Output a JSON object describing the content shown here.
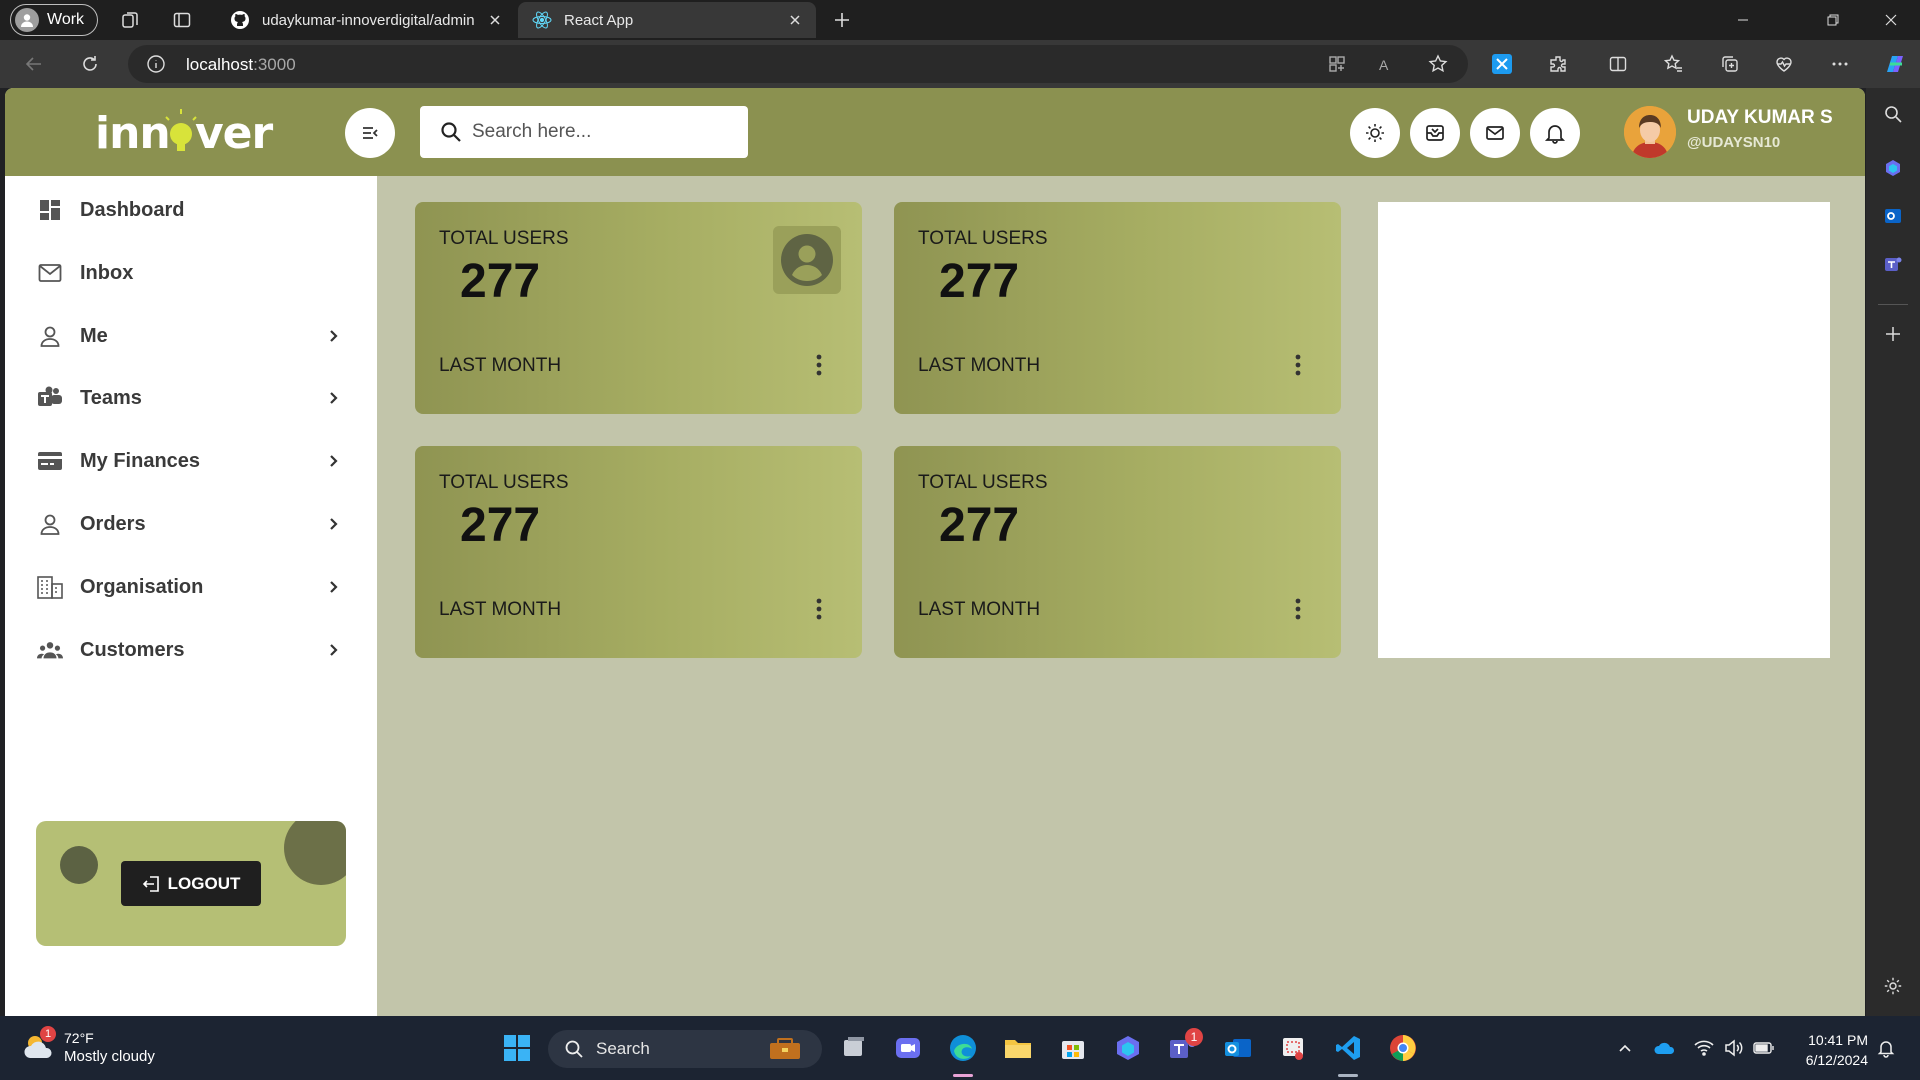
{
  "browser": {
    "profile_label": "Work",
    "tabs": [
      {
        "title": "udaykumar-innoverdigital/admin",
        "active": false
      },
      {
        "title": "React App",
        "active": true
      }
    ],
    "url_host": "localhost",
    "url_port": ":3000"
  },
  "app": {
    "logo_text": "innover",
    "search_placeholder": "Search here...",
    "user": {
      "name": "UDAY KUMAR S",
      "handle": "@UDAYSN10"
    },
    "sidebar": {
      "items": [
        {
          "label": "Dashboard",
          "icon": "dashboard-icon",
          "has_children": false
        },
        {
          "label": "Inbox",
          "icon": "mail-icon",
          "has_children": false
        },
        {
          "label": "Me",
          "icon": "person-icon",
          "has_children": true
        },
        {
          "label": "Teams",
          "icon": "teams-icon",
          "has_children": true
        },
        {
          "label": "My Finances",
          "icon": "card-icon",
          "has_children": true
        },
        {
          "label": "Orders",
          "icon": "person-icon",
          "has_children": true
        },
        {
          "label": "Organisation",
          "icon": "building-icon",
          "has_children": true
        },
        {
          "label": "Customers",
          "icon": "group-icon",
          "has_children": true
        }
      ],
      "logout_label": "LOGOUT"
    },
    "cards": [
      {
        "title": "TOTAL USERS",
        "value": "277",
        "footer": "LAST MONTH",
        "has_icon": true
      },
      {
        "title": "TOTAL USERS",
        "value": "277",
        "footer": "LAST MONTH",
        "has_icon": false
      },
      {
        "title": "TOTAL USERS",
        "value": "277",
        "footer": "LAST MONTH",
        "has_icon": false
      },
      {
        "title": "TOTAL USERS",
        "value": "277",
        "footer": "LAST MONTH",
        "has_icon": false
      }
    ],
    "colors": {
      "header": "#8b9150",
      "content_bg": "#c2c5aa",
      "logout_card": "#b5bf75"
    }
  },
  "taskbar": {
    "weather": {
      "temp": "72°F",
      "condition": "Mostly cloudy",
      "badge": "1"
    },
    "search_label": "Search",
    "teams_badge": "1",
    "time": "10:41 PM",
    "date": "6/12/2024"
  }
}
